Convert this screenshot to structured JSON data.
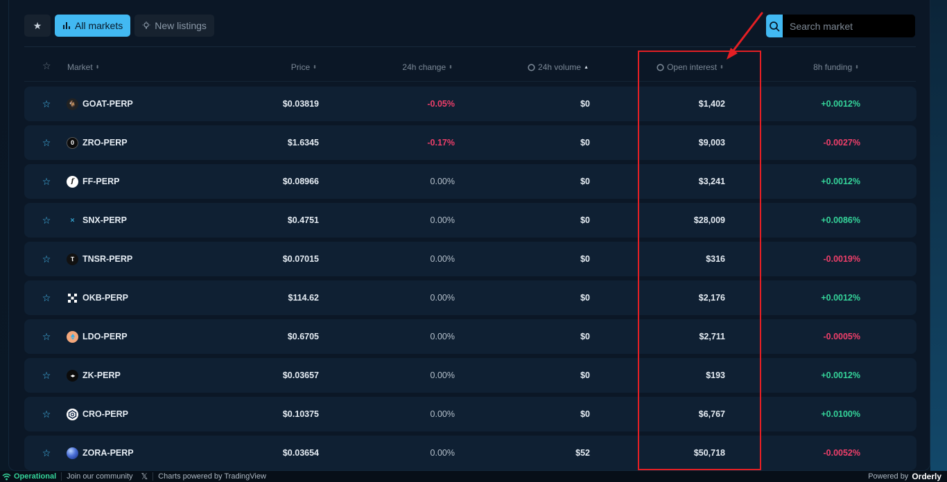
{
  "toolbar": {
    "favorites_icon": "star-icon",
    "all_markets_label": "All markets",
    "new_listings_label": "New listings"
  },
  "search": {
    "placeholder": "Search market",
    "value": ""
  },
  "table": {
    "headers": {
      "market": "Market",
      "price": "Price",
      "change": "24h change",
      "volume": "24h volume",
      "open_interest": "Open interest",
      "funding": "8h funding"
    },
    "rows": [
      {
        "market": "GOAT-PERP",
        "price": "$0.03819",
        "change": "-0.05%",
        "volume": "$0",
        "open_interest": "$1,402",
        "funding": "+0.0012%"
      },
      {
        "market": "ZRO-PERP",
        "price": "$1.6345",
        "change": "-0.17%",
        "volume": "$0",
        "open_interest": "$9,003",
        "funding": "-0.0027%"
      },
      {
        "market": "FF-PERP",
        "price": "$0.08966",
        "change": "0.00%",
        "volume": "$0",
        "open_interest": "$3,241",
        "funding": "+0.0012%"
      },
      {
        "market": "SNX-PERP",
        "price": "$0.4751",
        "change": "0.00%",
        "volume": "$0",
        "open_interest": "$28,009",
        "funding": "+0.0086%"
      },
      {
        "market": "TNSR-PERP",
        "price": "$0.07015",
        "change": "0.00%",
        "volume": "$0",
        "open_interest": "$316",
        "funding": "-0.0019%"
      },
      {
        "market": "OKB-PERP",
        "price": "$114.62",
        "change": "0.00%",
        "volume": "$0",
        "open_interest": "$2,176",
        "funding": "+0.0012%"
      },
      {
        "market": "LDO-PERP",
        "price": "$0.6705",
        "change": "0.00%",
        "volume": "$0",
        "open_interest": "$2,711",
        "funding": "-0.0005%"
      },
      {
        "market": "ZK-PERP",
        "price": "$0.03657",
        "change": "0.00%",
        "volume": "$0",
        "open_interest": "$193",
        "funding": "+0.0012%"
      },
      {
        "market": "CRO-PERP",
        "price": "$0.10375",
        "change": "0.00%",
        "volume": "$0",
        "open_interest": "$6,767",
        "funding": "+0.0100%"
      },
      {
        "market": "ZORA-PERP",
        "price": "$0.03654",
        "change": "0.00%",
        "volume": "$52",
        "open_interest": "$50,718",
        "funding": "-0.0052%"
      }
    ]
  },
  "footer": {
    "status": "Operational",
    "community": "Join our community",
    "charts": "Charts powered by TradingView",
    "powered_by": "Powered by",
    "brand": "Orderly"
  },
  "colors": {
    "accent": "#42b9f2",
    "positive": "#35d49a",
    "negative": "#ef3f6a",
    "highlight": "#e41f24"
  }
}
